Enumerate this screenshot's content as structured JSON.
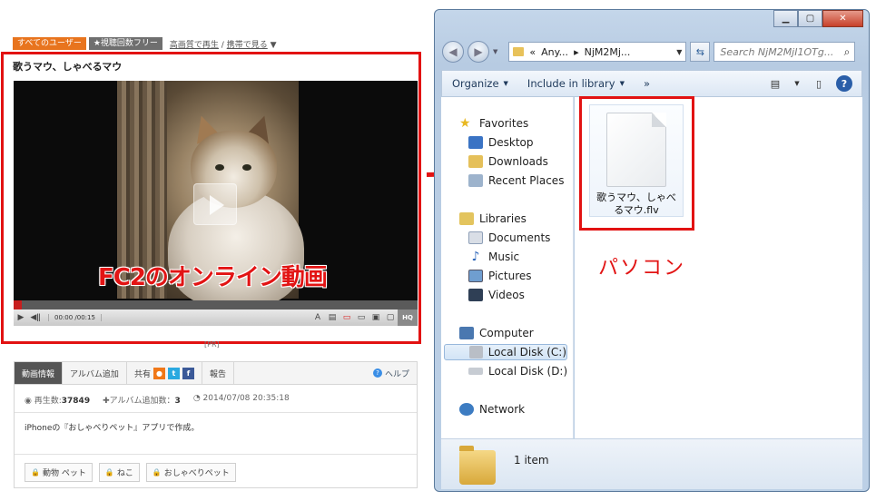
{
  "fc2": {
    "badges": [
      "すべてのユーザー",
      "★視聴回数フリー"
    ],
    "top_links": {
      "hq": "高画質で再生",
      "sep": " / ",
      "mobile": "携帯で見る",
      "arrow": "▼"
    },
    "video_title": "歌うマウ、しゃべるマウ",
    "overlay_caption": "FC2のオンライン動画",
    "player": {
      "time": "00:00 /00:15",
      "hq_label": "HQ",
      "progress_fraction": 0.02
    },
    "pr_label": "[PR]",
    "tabs": [
      "動画情報",
      "アルバム追加",
      "共有",
      "報告"
    ],
    "share_icons": [
      "fc2-icon",
      "twitter-icon",
      "facebook-icon"
    ],
    "help_label": "ヘルプ",
    "stats": {
      "plays_label": "再生数:",
      "plays_value": "37849",
      "album_label": "アルバム追加数：",
      "album_value": "3",
      "date": "2014/07/08 20:35:18"
    },
    "description": "iPhoneの『おしゃべりペット』アプリで作成。",
    "tags": [
      "動物 ペット",
      "ねこ",
      "おしゃべりペット"
    ]
  },
  "explorer": {
    "caption_buttons": [
      "minimize",
      "maximize",
      "close"
    ],
    "address": {
      "chevron": "«",
      "part1": "Any...",
      "sep": "▸",
      "part2": "NjM2Mj..."
    },
    "search_placeholder": "Search NjM2MjI1OTg...",
    "toolbar": {
      "organize": "Organize",
      "include": "Include in library",
      "more": "»"
    },
    "nav": {
      "favorites": "Favorites",
      "favorites_items": [
        "Desktop",
        "Downloads",
        "Recent Places"
      ],
      "libraries": "Libraries",
      "libraries_items": [
        "Documents",
        "Music",
        "Pictures",
        "Videos"
      ],
      "computer": "Computer",
      "computer_items": [
        "Local Disk (C:)",
        "Local Disk (D:)"
      ],
      "network": "Network"
    },
    "file_name": "歌うマウ、しゃべるマウ.flv",
    "overlay_label": "パソコン",
    "status_item_count": "1 item"
  },
  "colors": {
    "annotation_red": "#e21212",
    "fc2_orange": "#e8741e",
    "win_frame": "#b7cbe2"
  }
}
